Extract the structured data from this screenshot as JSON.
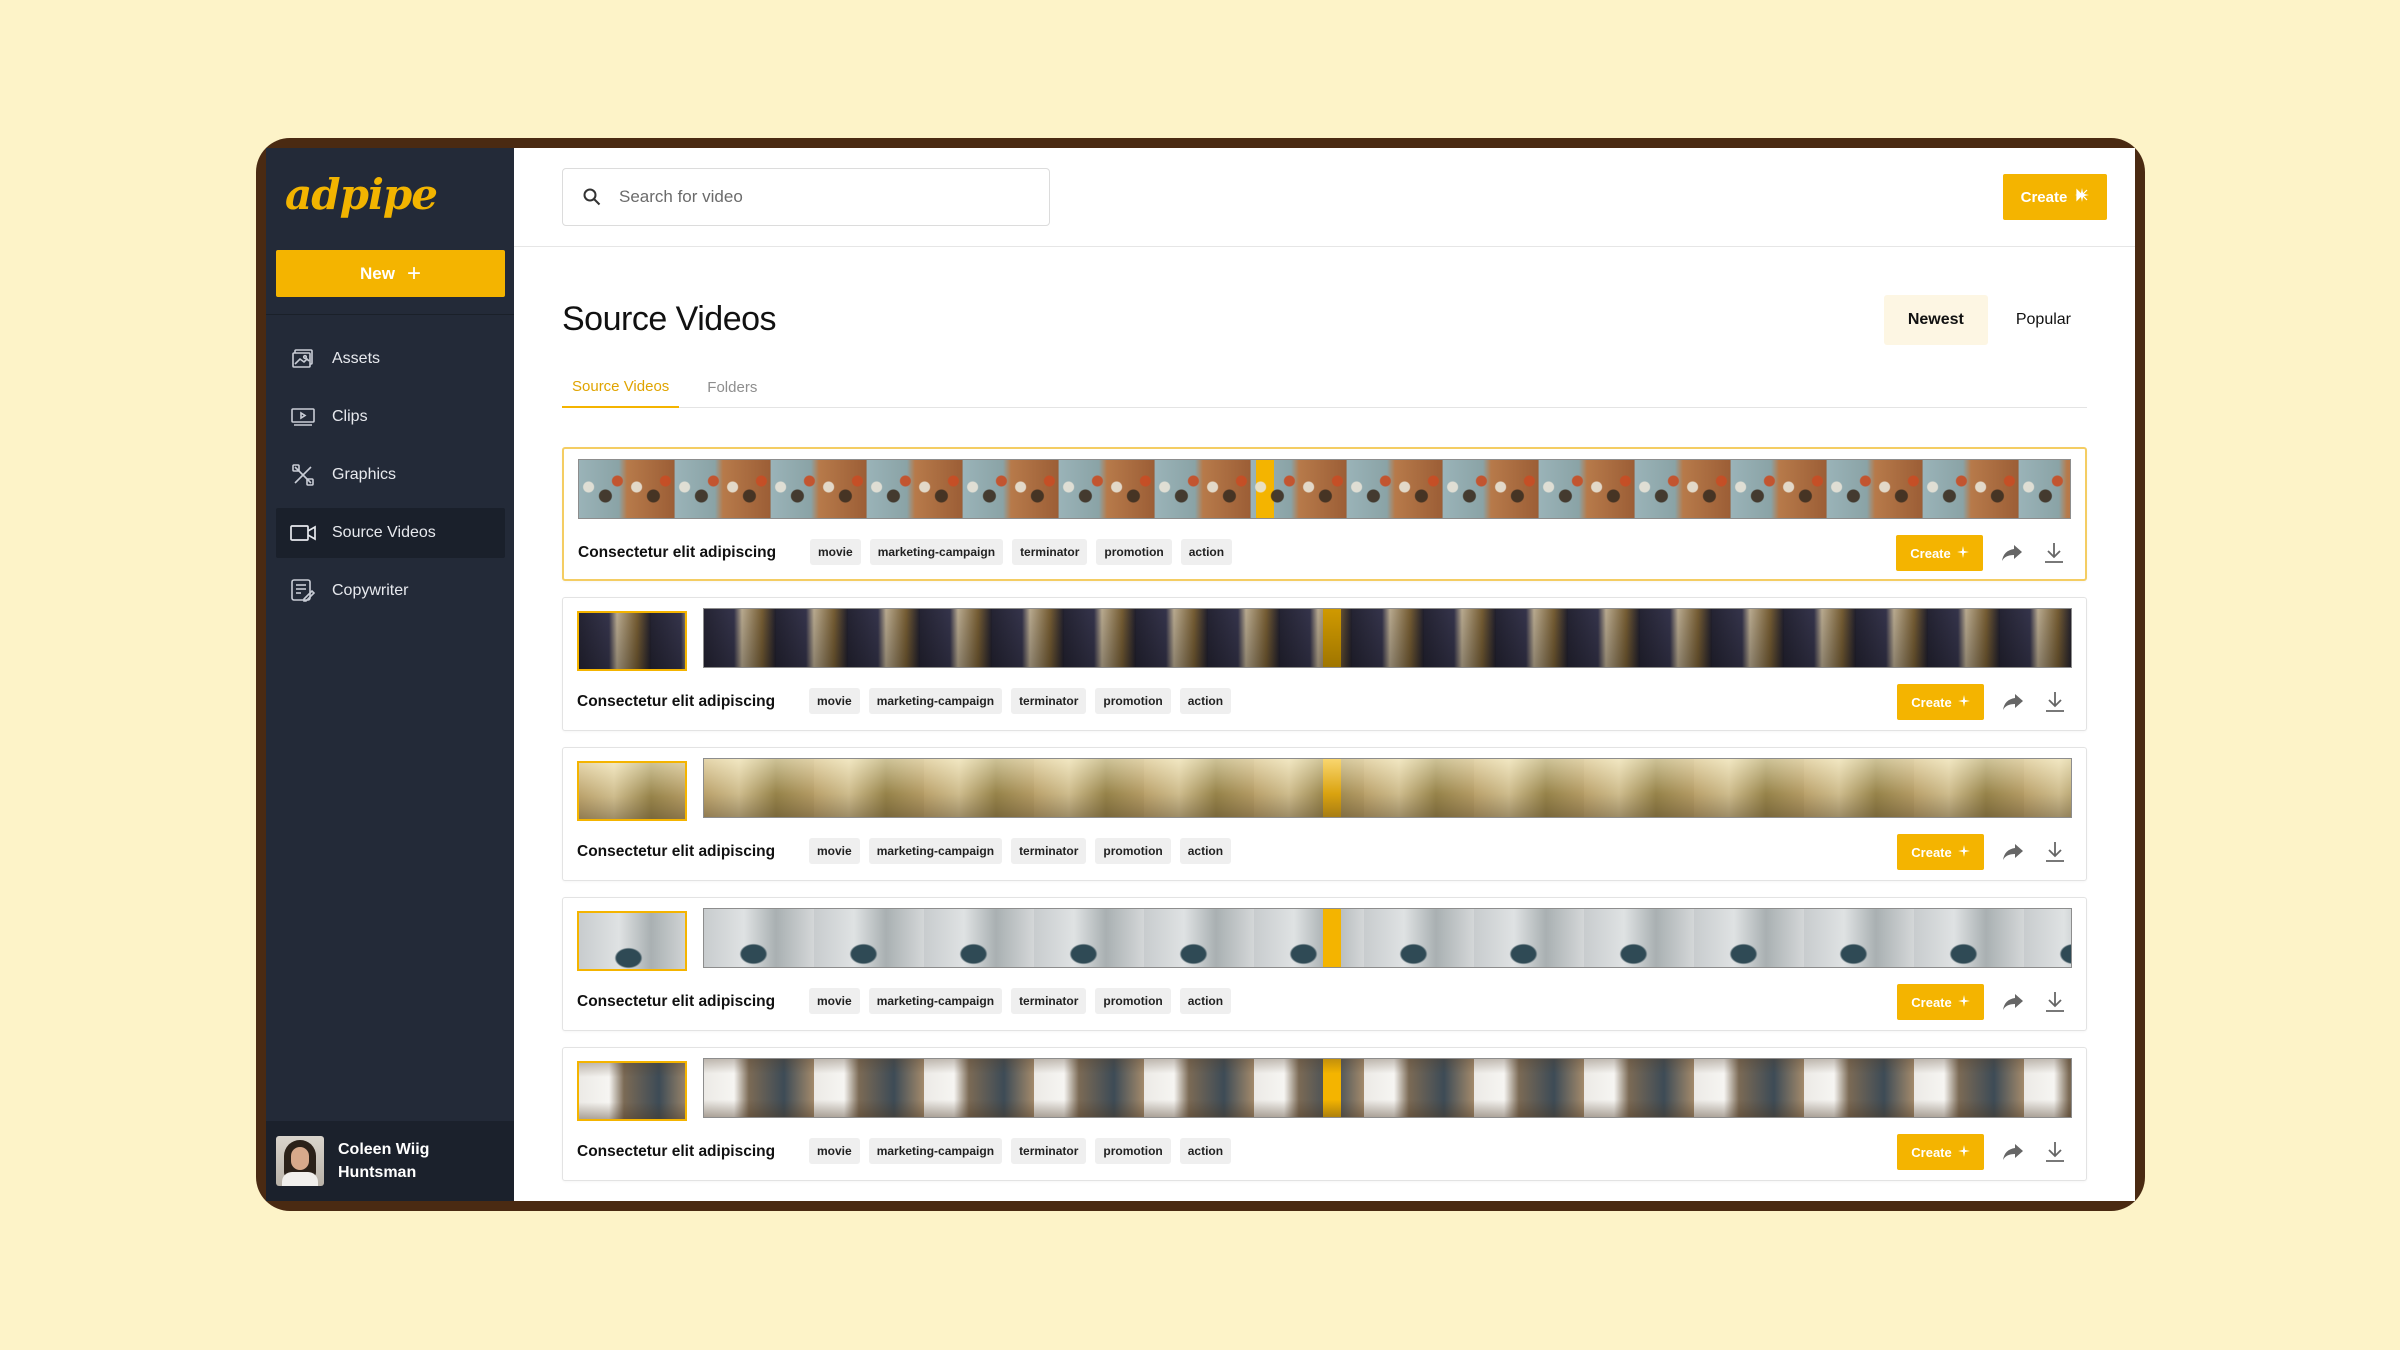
{
  "app": {
    "logo": "adpipe"
  },
  "sidebar": {
    "new_label": "New",
    "items": [
      {
        "label": "Assets",
        "icon": "image-icon"
      },
      {
        "label": "Clips",
        "icon": "clip-icon"
      },
      {
        "label": "Graphics",
        "icon": "graphics-icon"
      },
      {
        "label": "Source Videos",
        "icon": "video-camera-icon",
        "active": true
      },
      {
        "label": "Copywriter",
        "icon": "document-edit-icon"
      }
    ],
    "user": {
      "name_line1": "Coleen Wiig",
      "name_line2": "Huntsman"
    }
  },
  "topbar": {
    "search_placeholder": "Search for video",
    "create_label": "Create"
  },
  "main": {
    "title": "Source Videos",
    "sort": {
      "newest": "Newest",
      "popular": "Popular",
      "selected": "Newest"
    },
    "tabs": [
      {
        "label": "Source Videos",
        "active": true
      },
      {
        "label": "Folders",
        "active": false
      }
    ],
    "videos": [
      {
        "title": "Consectetur elit adipiscing",
        "tags": [
          "movie",
          "marketing-campaign",
          "terminator",
          "promotion",
          "action"
        ],
        "create_label": "Create"
      },
      {
        "title": "Consectetur elit adipiscing",
        "tags": [
          "movie",
          "marketing-campaign",
          "terminator",
          "promotion",
          "action"
        ],
        "create_label": "Create"
      },
      {
        "title": "Consectetur elit adipiscing",
        "tags": [
          "movie",
          "marketing-campaign",
          "terminator",
          "promotion",
          "action"
        ],
        "create_label": "Create"
      },
      {
        "title": "Consectetur elit adipiscing",
        "tags": [
          "movie",
          "marketing-campaign",
          "terminator",
          "promotion",
          "action"
        ],
        "create_label": "Create"
      },
      {
        "title": "Consectetur elit adipiscing",
        "tags": [
          "movie",
          "marketing-campaign",
          "terminator",
          "promotion",
          "action"
        ],
        "create_label": "Create"
      }
    ]
  },
  "colors": {
    "accent": "#f4b400",
    "sidebar_bg": "#232a38",
    "page_bg": "#fdf3c8",
    "frame": "#4a2a12"
  }
}
